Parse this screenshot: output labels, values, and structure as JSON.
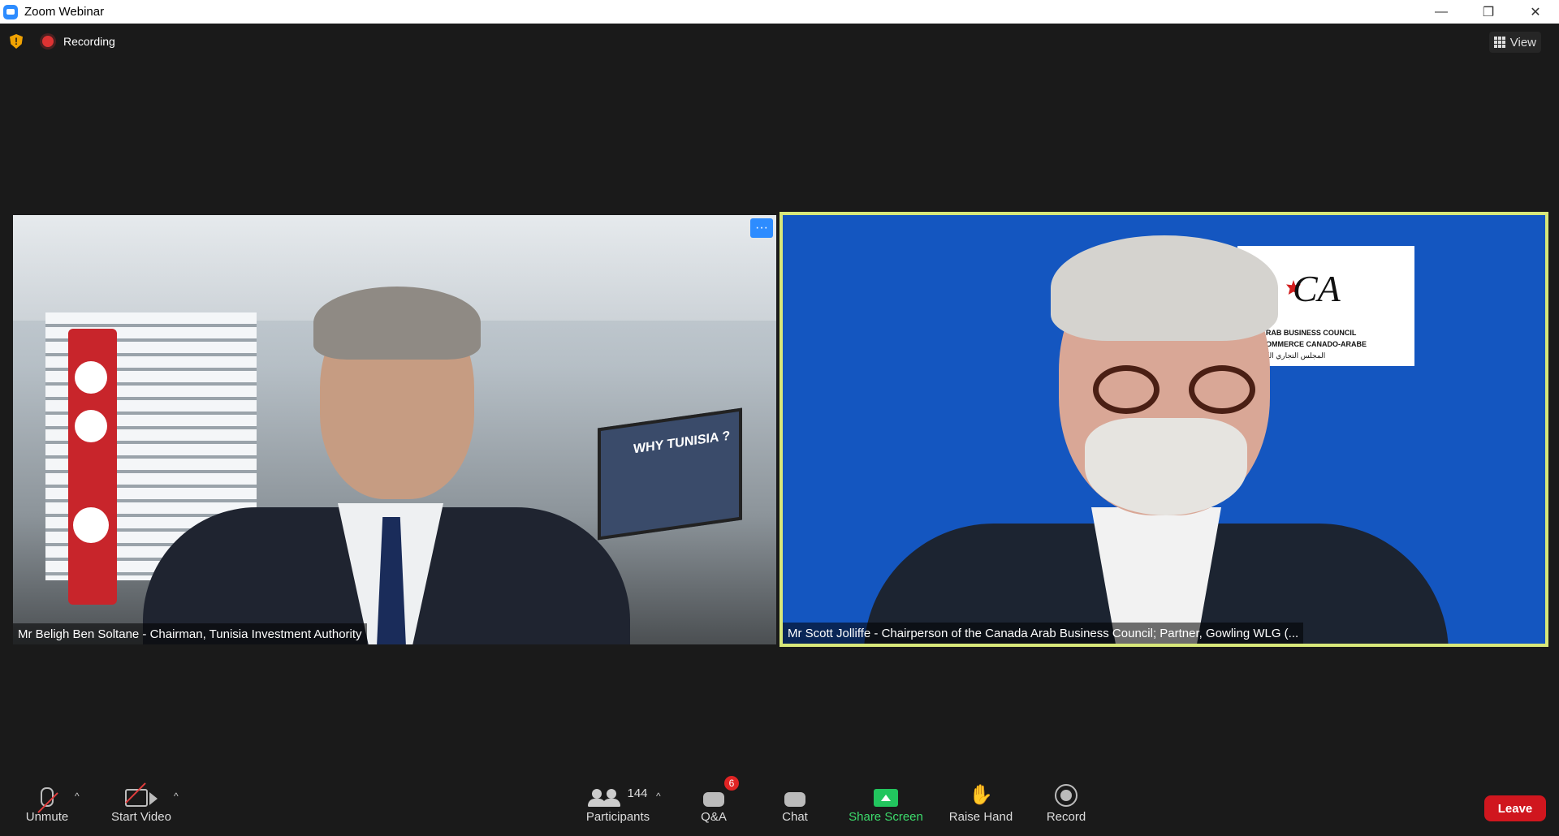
{
  "window": {
    "title": "Zoom Webinar",
    "controls": {
      "minimize": "—",
      "restore": "❐",
      "close": "✕"
    }
  },
  "meeting_bar": {
    "recording_label": "Recording",
    "view_label": "View"
  },
  "tiles": [
    {
      "name": "Mr Beligh Ben Soltane - Chairman, Tunisia Investment Authority",
      "more_label": "···",
      "tv_text": "WHY TUNISIA ?"
    },
    {
      "name": "Mr Scott Jolliffe - Chairperson of the Canada Arab Business Council; Partner, Gowling WLG (...",
      "logo": {
        "mark": "CA",
        "line1": "A ARAB BUSINESS COUNCIL",
        "line2": "E COMMERCE CANADO-ARABE",
        "line3": "المجلس التجاري الكندي"
      }
    }
  ],
  "toolbar": {
    "unmute": "Unmute",
    "start_video": "Start Video",
    "participants": "Participants",
    "participants_count": "144",
    "qa": "Q&A",
    "qa_badge": "6",
    "chat": "Chat",
    "share_screen": "Share Screen",
    "raise_hand": "Raise Hand",
    "record": "Record",
    "leave": "Leave",
    "caret": "^"
  },
  "colors": {
    "accent": "#2d8cff",
    "share": "#22c55e",
    "leave": "#d0161e",
    "speaker_border": "#d8e87a"
  }
}
